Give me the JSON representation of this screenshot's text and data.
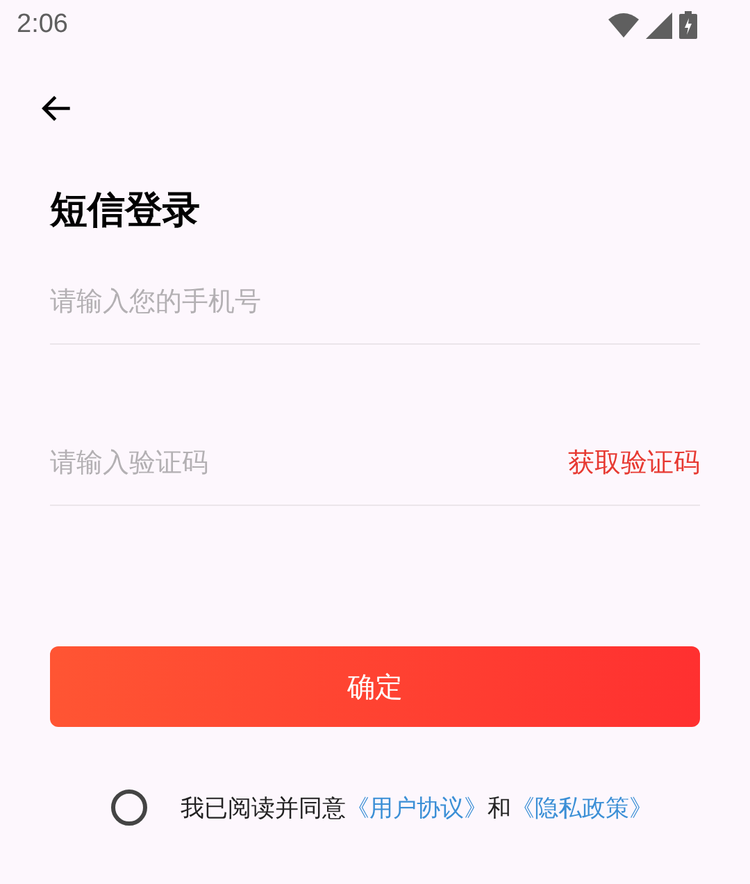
{
  "status_bar": {
    "time": "2:06"
  },
  "title": "短信登录",
  "phone_field": {
    "placeholder": "请输入您的手机号"
  },
  "code_field": {
    "placeholder": "请输入验证码",
    "action": "获取验证码"
  },
  "submit_button": "确定",
  "agreement": {
    "checked": false,
    "parts": [
      {
        "kind": "text",
        "text": "我已阅读并同意"
      },
      {
        "kind": "link",
        "text": "《用户协议》"
      },
      {
        "kind": "text",
        "text": "和"
      },
      {
        "kind": "link",
        "text": "《隐私政策》"
      }
    ]
  }
}
